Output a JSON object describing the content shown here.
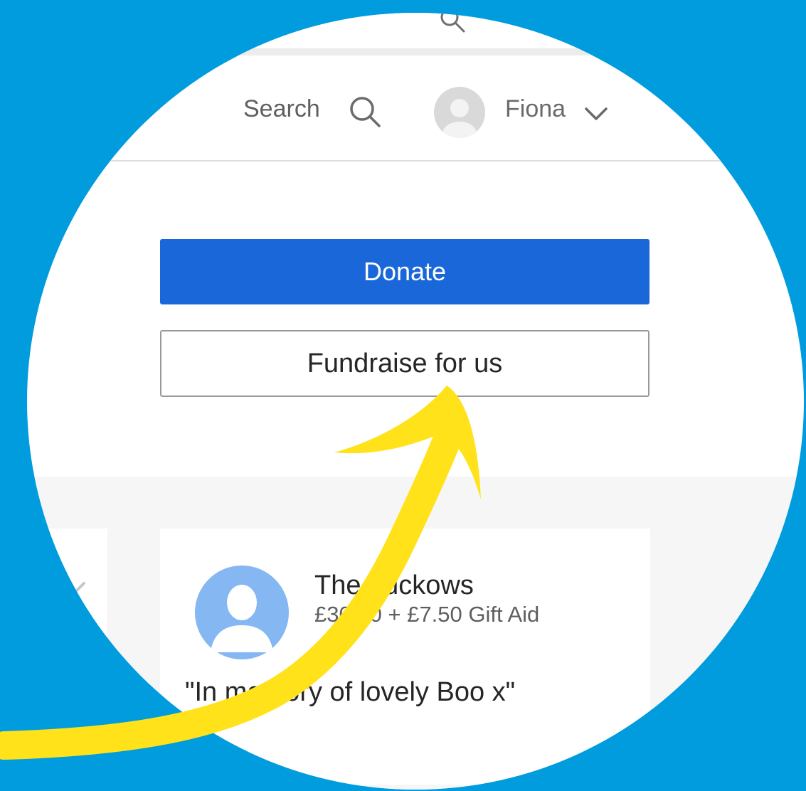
{
  "colors": {
    "background": "#009CDE",
    "donate_button": "#1A67D9",
    "annotation_arrow": "#FFE21A",
    "donor_avatar": "#85B7F2"
  },
  "header": {
    "search_label": "Search",
    "search_icon": "search-icon",
    "user": {
      "name": "Fiona",
      "avatar_icon": "user-avatar",
      "menu_icon": "chevron-down-icon"
    }
  },
  "actions": {
    "donate_label": "Donate",
    "fundraise_label": "Fundraise for us"
  },
  "donation": {
    "donor_name": "The Luckows",
    "amount": "£30.00 + £7.50 Gift Aid",
    "message": "\"In memory of lovely Boo x\"",
    "avatar_icon": "default-user-icon"
  },
  "annotation": {
    "type": "arrow",
    "points_to": "fundraise-button"
  }
}
